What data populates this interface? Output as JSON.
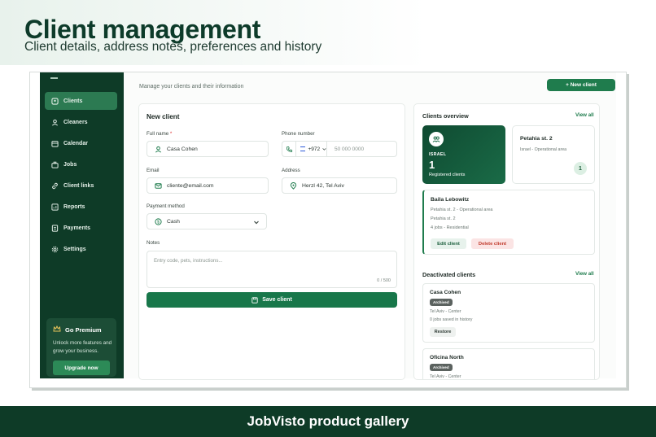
{
  "hero": {
    "title": "Client management",
    "subtitle": "Client details, address notes, preferences and history"
  },
  "sidebar": {
    "items": [
      {
        "label": "Clients",
        "icon": "users-icon",
        "active": true
      },
      {
        "label": "Cleaners",
        "icon": "user-group-icon",
        "active": false
      },
      {
        "label": "Calendar",
        "icon": "calendar-icon",
        "active": false
      },
      {
        "label": "Jobs",
        "icon": "briefcase-icon",
        "active": false
      },
      {
        "label": "Client links",
        "icon": "link-icon",
        "active": false
      },
      {
        "label": "Reports",
        "icon": "chart-icon",
        "active": false
      },
      {
        "label": "Payments",
        "icon": "receipt-icon",
        "active": false
      },
      {
        "label": "Settings",
        "icon": "gear-icon",
        "active": false
      }
    ],
    "premium": {
      "title": "Go Premium",
      "description": "Unlock more features and grow your business.",
      "button": "Upgrade now"
    }
  },
  "header": {
    "subtitle": "Manage your clients and their information",
    "new_client_button": "+ New client"
  },
  "form": {
    "title": "New client",
    "full_name": {
      "label": "Full name",
      "required_mark": "*",
      "value": "Casa Cohen"
    },
    "phone": {
      "label": "Phone number",
      "country_code": "+972",
      "placeholder": "50 000 0000"
    },
    "email": {
      "label": "Email",
      "value": "cliente@email.com"
    },
    "address": {
      "label": "Address",
      "value": "Herzl 42, Tel Aviv"
    },
    "payment": {
      "label": "Payment method",
      "value": "Cash"
    },
    "notes": {
      "label": "Notes",
      "placeholder": "Entry code, pets, instructions...",
      "counter": "0 / 500"
    },
    "save_button": "Save client"
  },
  "overview": {
    "title": "Clients overview",
    "view_all": "View all",
    "stat": {
      "country": "ISRAEL",
      "count": "1",
      "label": "Registered clients"
    },
    "address_card": {
      "name": "Petahia st. 2",
      "sub": "Israel - Operational area",
      "count": "1"
    },
    "client": {
      "name": "Baila Lebowitz",
      "line1": "Petahia st. 2 - Operational area",
      "line2": "Petahia st. 2",
      "line3": "4 jobs - Residential",
      "edit": "Edit client",
      "delete": "Delete client"
    }
  },
  "deactivated": {
    "title": "Deactivated clients",
    "view_all": "View all",
    "items": [
      {
        "name": "Casa Cohen",
        "badge": "Archived",
        "location": "Tel Aviv - Center",
        "history": "0 jobs saved in history",
        "restore": "Restore"
      },
      {
        "name": "Oficina North",
        "badge": "Archived",
        "location": "Tel Aviv - Center"
      }
    ]
  },
  "footer": {
    "text": "JobVisto product gallery"
  },
  "colors": {
    "brand_dark": "#0e3b27",
    "brand": "#18774a",
    "danger": "#c0392b"
  }
}
